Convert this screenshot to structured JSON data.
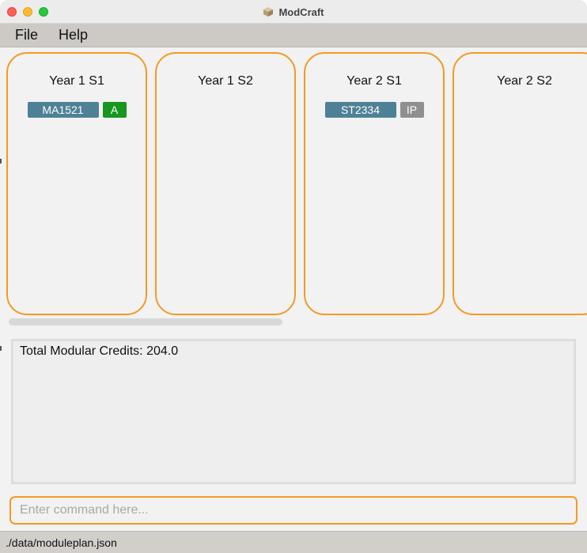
{
  "window": {
    "title": "ModCraft"
  },
  "menu": {
    "items": [
      "File",
      "Help"
    ]
  },
  "semesters": [
    {
      "title": "Year 1 S1",
      "modules": [
        {
          "code": "MA1521",
          "grade": "A"
        }
      ]
    },
    {
      "title": "Year 1 S2",
      "modules": []
    },
    {
      "title": "Year 2 S1",
      "modules": [
        {
          "code": "ST2334",
          "grade": "IP"
        }
      ]
    },
    {
      "title": "Year 2 S2",
      "modules": []
    }
  ],
  "result": {
    "text": "Total Modular Credits: 204.0"
  },
  "command": {
    "placeholder": "Enter command here...",
    "value": ""
  },
  "status": {
    "path": "./data/moduleplan.json"
  },
  "colors": {
    "accent": "#f39a22",
    "module_tag": "#4e8196",
    "grade_green": "#18961f",
    "grade_gray": "#8f8f8f"
  },
  "icons": {
    "app": "package-icon"
  }
}
